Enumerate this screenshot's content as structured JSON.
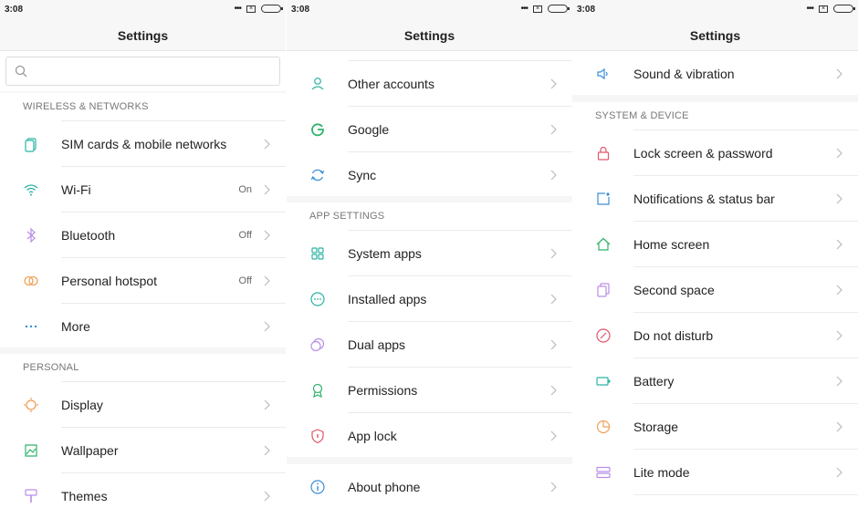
{
  "status": {
    "time": "3:08"
  },
  "panels": [
    {
      "title": "Settings",
      "sections": [
        {
          "header": "WIRELESS & NETWORKS",
          "items": [
            {
              "label": "SIM cards & mobile networks",
              "value": "",
              "icon": "sim-cards-icon"
            },
            {
              "label": "Wi-Fi",
              "value": "On",
              "icon": "wifi-icon"
            },
            {
              "label": "Bluetooth",
              "value": "Off",
              "icon": "bluetooth-icon"
            },
            {
              "label": "Personal hotspot",
              "value": "Off",
              "icon": "hotspot-icon"
            },
            {
              "label": "More",
              "value": "",
              "icon": "more-dots-icon"
            }
          ]
        },
        {
          "header": "PERSONAL",
          "items": [
            {
              "label": "Display",
              "value": "",
              "icon": "display-sun-icon"
            },
            {
              "label": "Wallpaper",
              "value": "",
              "icon": "wallpaper-icon"
            },
            {
              "label": "Themes",
              "value": "",
              "icon": "themes-icon"
            }
          ]
        }
      ]
    },
    {
      "title": "Settings",
      "sections": [
        {
          "header": "",
          "items": [
            {
              "label": "Other accounts",
              "value": "",
              "icon": "account-icon"
            },
            {
              "label": "Google",
              "value": "",
              "icon": "google-icon"
            },
            {
              "label": "Sync",
              "value": "",
              "icon": "sync-icon"
            }
          ]
        },
        {
          "header": "APP SETTINGS",
          "items": [
            {
              "label": "System apps",
              "value": "",
              "icon": "system-apps-icon"
            },
            {
              "label": "Installed apps",
              "value": "",
              "icon": "installed-apps-icon"
            },
            {
              "label": "Dual apps",
              "value": "",
              "icon": "dual-apps-icon"
            },
            {
              "label": "Permissions",
              "value": "",
              "icon": "permissions-icon"
            },
            {
              "label": "App lock",
              "value": "",
              "icon": "app-lock-icon"
            }
          ]
        },
        {
          "header": "",
          "items": [
            {
              "label": "About phone",
              "value": "",
              "icon": "about-phone-icon"
            }
          ]
        }
      ]
    },
    {
      "title": "Settings",
      "sections": [
        {
          "header": "",
          "items": [
            {
              "label": "Sound & vibration",
              "value": "",
              "icon": "sound-icon"
            }
          ]
        },
        {
          "header": "SYSTEM & DEVICE",
          "items": [
            {
              "label": "Lock screen & password",
              "value": "",
              "icon": "lock-icon"
            },
            {
              "label": "Notifications & status bar",
              "value": "",
              "icon": "notifications-icon"
            },
            {
              "label": "Home screen",
              "value": "",
              "icon": "home-icon"
            },
            {
              "label": "Second space",
              "value": "",
              "icon": "second-space-icon"
            },
            {
              "label": "Do not disturb",
              "value": "",
              "icon": "do-not-disturb-icon"
            },
            {
              "label": "Battery",
              "value": "",
              "icon": "battery-icon"
            },
            {
              "label": "Storage",
              "value": "",
              "icon": "storage-icon"
            },
            {
              "label": "Lite mode",
              "value": "",
              "icon": "lite-mode-icon"
            }
          ]
        }
      ]
    }
  ],
  "colors": {
    "teal": "#2bb3a3",
    "purple": "#b98ee6",
    "orange": "#f0a057",
    "green": "#2db36b",
    "red": "#e0566a",
    "blue": "#3a8fd6"
  }
}
